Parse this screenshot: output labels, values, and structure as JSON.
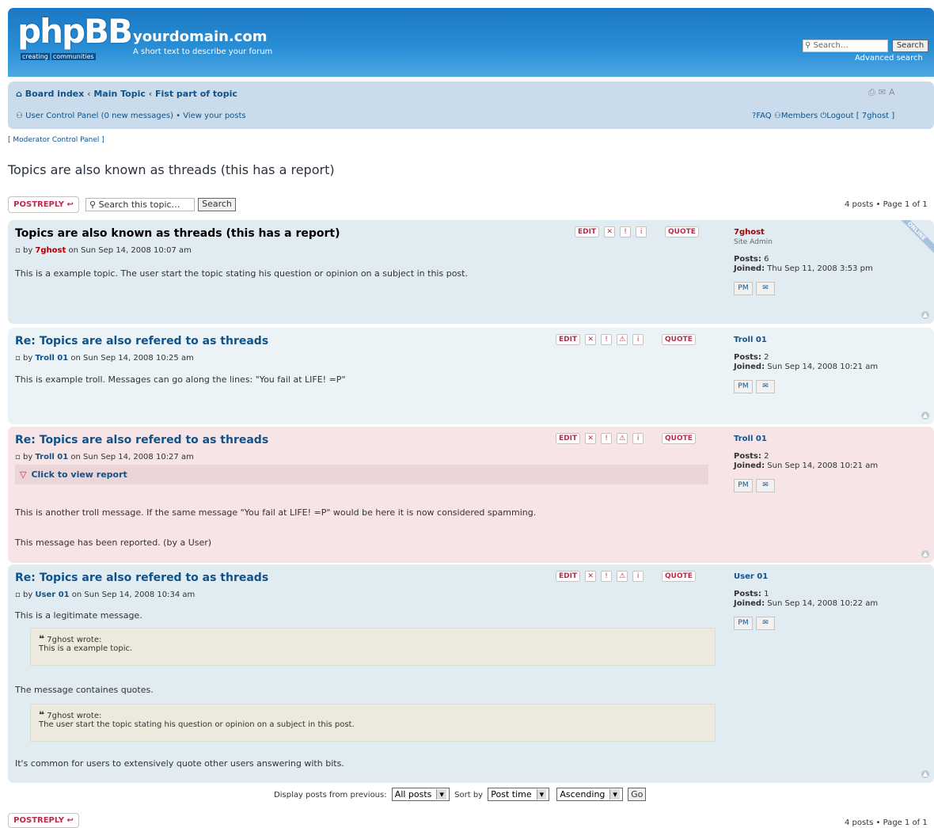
{
  "header": {
    "logo_text": "phpBB",
    "logo_sub": [
      "creating",
      "communities"
    ],
    "site_name": "yourdomain.com",
    "site_desc": "A short text to describe your forum",
    "search_placeholder": "Search…",
    "search_button": "Search",
    "advanced_search": "Advanced search"
  },
  "navbar": {
    "crumbs": [
      "Board index",
      "Main Topic",
      "Fist part of topic"
    ],
    "crumb_sep": "‹",
    "ucp": "User Control Panel",
    "new_messages": "(0 new messages)",
    "view_posts": "View your posts",
    "faq": "FAQ",
    "members": "Members",
    "logout": "Logout [ 7ghost ]",
    "mcp": "[ Moderator Control Panel ]"
  },
  "topic": {
    "title": "Topics are also known as threads (this has a report)",
    "post_reply": "POSTREPLY",
    "search_placeholder": "Search this topic…",
    "search_button": "Search",
    "pagination": "4 posts • Page 1 of 1"
  },
  "buttons": {
    "edit": "EDIT",
    "quote": "QUOTE",
    "pm": "PM"
  },
  "posts": [
    {
      "title": "Topics are also known as threads (this has a report)",
      "author_prefix": "by",
      "author": "7ghost",
      "date": "on Sun Sep 14, 2008 10:07 am",
      "body": "This is a example topic. The user start the topic stating his question or opinion on a subject in this post.",
      "profile_name": "7ghost",
      "rank": "Site Admin",
      "posts_label": "Posts:",
      "posts_count": "6",
      "joined_label": "Joined:",
      "joined": "Thu Sep 11, 2008 3:53 pm",
      "online": "ONLINE"
    },
    {
      "title": "Re: Topics are also refered to as threads",
      "author_prefix": "by",
      "author": "Troll 01",
      "date": "on Sun Sep 14, 2008 10:25 am",
      "body": "This is example troll. Messages can go along the lines: \"You fail at LIFE! =P\"",
      "profile_name": "Troll 01",
      "posts_label": "Posts:",
      "posts_count": "2",
      "joined_label": "Joined:",
      "joined": "Sun Sep 14, 2008 10:21 am"
    },
    {
      "title": "Re: Topics are also refered to as threads",
      "author_prefix": "by",
      "author": "Troll 01",
      "date": "on Sun Sep 14, 2008 10:27 am",
      "report_link": "Click to view report",
      "body": "This is another troll message. If the same message \"You fail at LIFE! =P\" would be here it is now considered spamming.",
      "reported_note": "This message has been reported. (by a User)",
      "profile_name": "Troll 01",
      "posts_label": "Posts:",
      "posts_count": "2",
      "joined_label": "Joined:",
      "joined": "Sun Sep 14, 2008 10:21 am"
    },
    {
      "title": "Re: Topics are also refered to as threads",
      "author_prefix": "by",
      "author": "User 01",
      "date": "on Sun Sep 14, 2008 10:34 am",
      "body": "This is a legitimate message.",
      "quote1_author": "7ghost wrote:",
      "quote1_text": "This is a example topic.",
      "body2": "The message containes quotes.",
      "quote2_author": "7ghost wrote:",
      "quote2_text": "The user start the topic stating his question or opinion on a subject in this post.",
      "body3": "It's common for users to extensively quote other users answering with bits.",
      "profile_name": "User 01",
      "posts_label": "Posts:",
      "posts_count": "1",
      "joined_label": "Joined:",
      "joined": "Sun Sep 14, 2008 10:22 am"
    }
  ],
  "display": {
    "label": "Display posts from previous:",
    "period": "All posts",
    "sort_label": "Sort by",
    "sort_key": "Post time",
    "direction": "Ascending",
    "go": "Go"
  },
  "colors": {
    "header_blue": "#1a78c4",
    "navbar_bg": "#cadceb",
    "post_bg1": "#ecf3f7",
    "post_bg2": "#e1ebf2",
    "reported_bg": "#f6e4e6",
    "link": "#105289",
    "button_red": "#bc2a4d"
  }
}
